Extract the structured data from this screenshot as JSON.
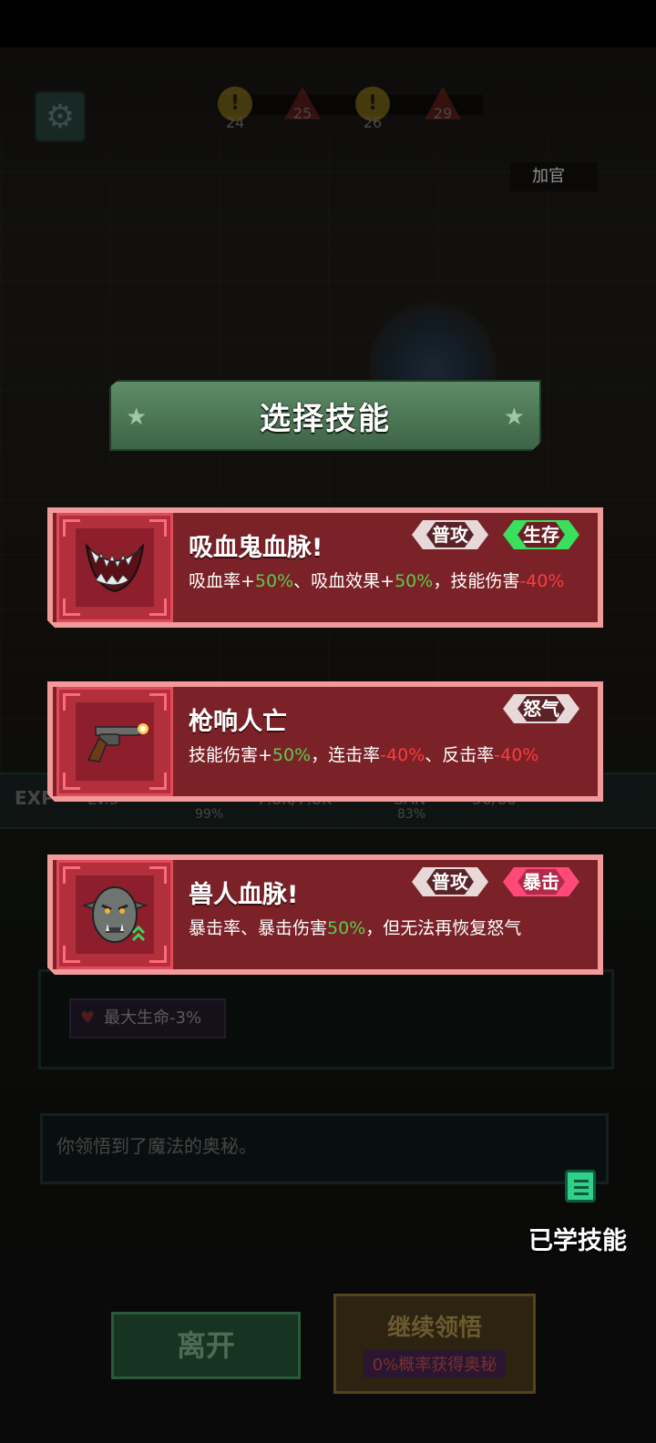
{
  "hud": {
    "waves": [
      {
        "num": "24",
        "kind": "circle"
      },
      {
        "num": "25",
        "kind": "triangle"
      },
      {
        "num": "26",
        "kind": "circle"
      },
      {
        "num": "29",
        "kind": "triangle"
      }
    ],
    "add_office_label": "加官"
  },
  "dialog": {
    "title": "选择技能",
    "skills": [
      {
        "name": "吸血鬼血脉!",
        "icon": "fangs-icon",
        "tags": [
          {
            "label": "普攻",
            "style": "gray"
          },
          {
            "label": "生存",
            "style": "green"
          }
        ],
        "desc": [
          {
            "t": "吸血率+",
            "c": ""
          },
          {
            "t": "50%",
            "c": "g"
          },
          {
            "t": "、吸血效果+",
            "c": ""
          },
          {
            "t": "50%",
            "c": "g"
          },
          {
            "t": "，技能伤害",
            "c": ""
          },
          {
            "t": "-40%",
            "c": "r"
          }
        ]
      },
      {
        "name": "枪响人亡",
        "icon": "revolver-icon",
        "tags": [
          {
            "label": "怒气",
            "style": "gray"
          }
        ],
        "desc": [
          {
            "t": "技能伤害+",
            "c": ""
          },
          {
            "t": "50%",
            "c": "g"
          },
          {
            "t": "，连击率",
            "c": ""
          },
          {
            "t": "-40%",
            "c": "r"
          },
          {
            "t": "、反击率",
            "c": ""
          },
          {
            "t": "-40%",
            "c": "r"
          }
        ]
      },
      {
        "name": "兽人血脉!",
        "icon": "orc-head-icon",
        "tags": [
          {
            "label": "普攻",
            "style": "gray"
          },
          {
            "label": "暴击",
            "style": "pink"
          }
        ],
        "desc": [
          {
            "t": "暴击率、暴击伤害",
            "c": ""
          },
          {
            "t": "50%",
            "c": "g"
          },
          {
            "t": "，但无法再恢复怒气",
            "c": ""
          }
        ]
      }
    ]
  },
  "background": {
    "exp_label": "EXP",
    "level": "Lv.5",
    "pct1": "99%",
    "hp_text": "7.8K/7.8K",
    "san_label": "SAN",
    "pct2": "83%",
    "counter": "50/60",
    "hp_effect": "最大生命-3%",
    "message": "你领悟到了魔法的奥秘。"
  },
  "learned_skills_label": "已学技能",
  "buttons": {
    "leave": "离开",
    "continue": "继续领悟",
    "continue_sub": "0%概率获得奥秘"
  },
  "colors": {
    "positive": "#5ccc4c",
    "negative": "#ff3b3b",
    "card_border": "#f29a9a",
    "card_bg": "#7a2228",
    "banner": "#4f7a58"
  }
}
